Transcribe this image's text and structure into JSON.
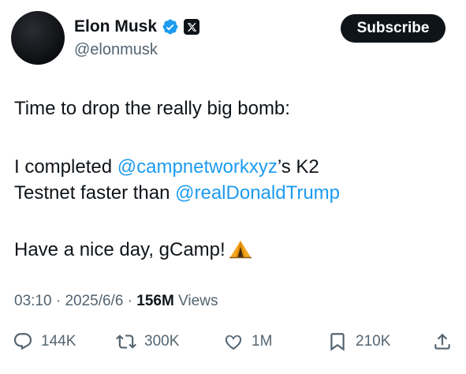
{
  "author": {
    "display_name": "Elon Musk",
    "handle": "@elonmusk",
    "verified_icon": "verified-badge-icon",
    "affiliation_icon": "x-logo-icon"
  },
  "subscribe_label": "Subscribe",
  "tweet": {
    "line1": "Time to drop the really big bomb:",
    "line2_prefix": "I completed ",
    "line2_mention": "@campnetworkxyz",
    "line2_suffix": "’s K2",
    "line3_prefix": "Testnet faster than ",
    "line3_mention": "@realDonaldTrump",
    "line4": "Have a nice day, gCamp!",
    "emoji_icon": "tent-icon"
  },
  "meta": {
    "time": "03:10",
    "separator": " · ",
    "date": "2025/6/6",
    "views_count": "156M",
    "views_label": " Views"
  },
  "actions": {
    "replies": "144K",
    "reposts": "300K",
    "likes": "1M",
    "bookmarks": "210K"
  },
  "colors": {
    "accent": "#1d9bf0",
    "text": "#0f1419",
    "muted": "#536471",
    "verified": "#1d9bf0"
  }
}
